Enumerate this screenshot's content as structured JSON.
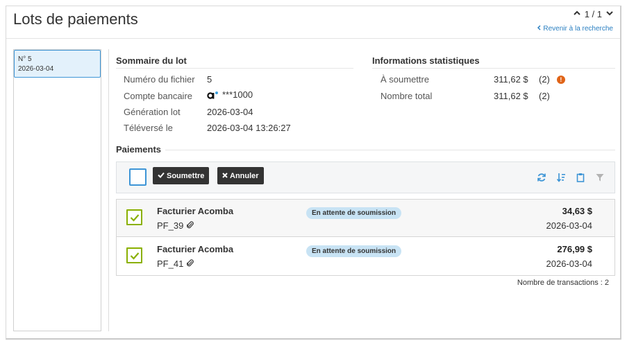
{
  "header": {
    "title": "Lots de paiements",
    "pager": "1 / 1",
    "back_link": "Revenir à la recherche"
  },
  "left": {
    "item_number": "N° 5",
    "item_date": "2026-03-04"
  },
  "summary": {
    "title": "Sommaire du lot",
    "rows": [
      {
        "label": "Numéro du fichier",
        "value": "5"
      },
      {
        "label": "Compte bancaire",
        "value": "***1000"
      },
      {
        "label": "Génération lot",
        "value": "2026-03-04"
      },
      {
        "label": "Téléversé le",
        "value": "2026-03-04 13:26:27"
      }
    ]
  },
  "stats": {
    "title": "Informations statistiques",
    "rows": [
      {
        "label": "À soumettre",
        "amount": "311,62 $",
        "count": "(2)"
      },
      {
        "label": "Nombre total",
        "amount": "311,62 $",
        "count": "(2)"
      }
    ]
  },
  "payments": {
    "title": "Paiements",
    "submit_label": "Soumettre",
    "cancel_label": "Annuler",
    "items": [
      {
        "name": "Facturier Acomba",
        "ref": "PF_39",
        "status": "En attente de soumission",
        "amount": "34,63 $",
        "date": "2026-03-04"
      },
      {
        "name": "Facturier Acomba",
        "ref": "PF_41",
        "status": "En attente de soumission",
        "amount": "276,99 $",
        "date": "2026-03-04"
      }
    ],
    "count_text": "Nombre de transactions : 2"
  },
  "colors": {
    "accent_blue": "#3d95d6",
    "check_green": "#8ab000",
    "warning_orange": "#e06418",
    "status_pill": "#c8e3f4"
  },
  "icons": [
    "chevron-up-icon",
    "chevron-down-icon",
    "chevron-left-icon",
    "bank-logo-icon",
    "warning-icon",
    "check-icon",
    "times-icon",
    "refresh-icon",
    "sort-icon",
    "clipboard-icon",
    "filter-icon",
    "paperclip-icon"
  ]
}
